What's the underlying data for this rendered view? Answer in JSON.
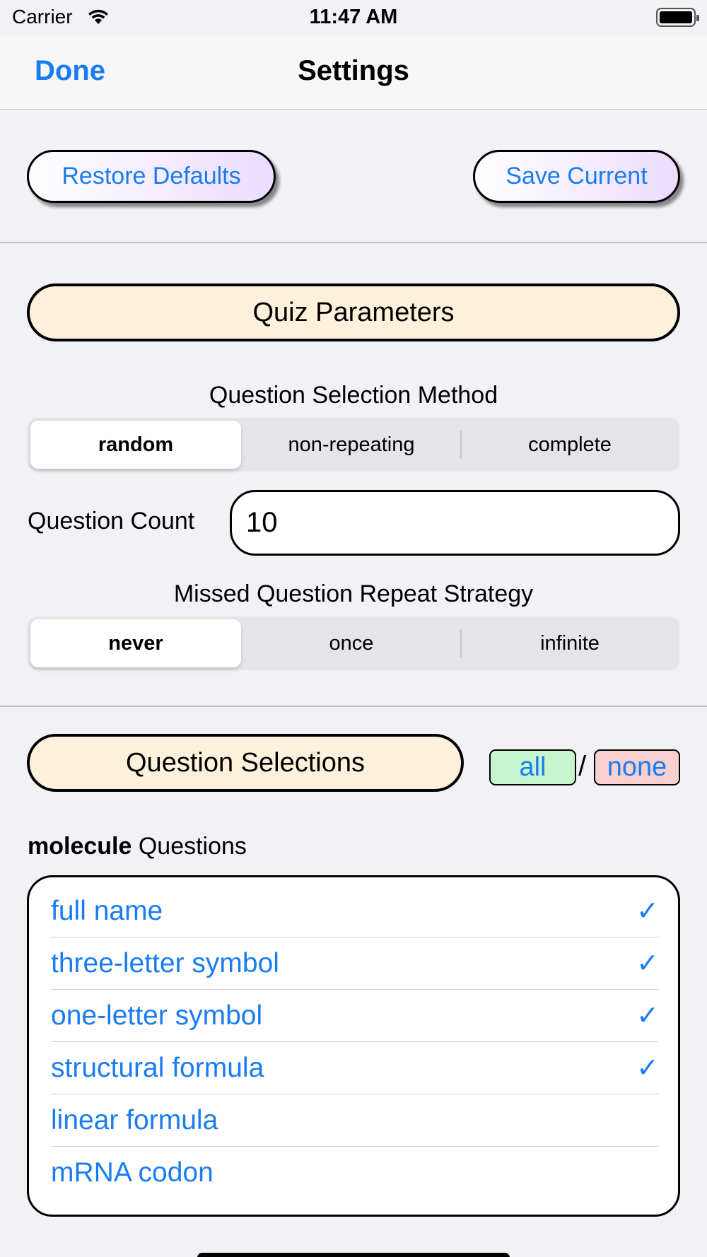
{
  "status_bar": {
    "carrier": "Carrier",
    "time": "11:47 AM"
  },
  "nav": {
    "done_label": "Done",
    "title": "Settings"
  },
  "actions": {
    "restore_label": "Restore Defaults",
    "save_label": "Save Current"
  },
  "quiz_parameters": {
    "header": "Quiz Parameters",
    "selection_method": {
      "label": "Question Selection Method",
      "options": [
        "random",
        "non-repeating",
        "complete"
      ],
      "selected": "random"
    },
    "question_count": {
      "label": "Question Count",
      "value": "10"
    },
    "repeat_strategy": {
      "label": "Missed Question Repeat Strategy",
      "options": [
        "never",
        "once",
        "infinite"
      ],
      "selected": "never"
    }
  },
  "question_selections": {
    "header": "Question Selections",
    "all_label": "all",
    "separator": "/",
    "none_label": "none",
    "group_bold": "molecule",
    "group_suffix": " Questions",
    "check_glyph": "✓",
    "items": [
      {
        "label": "full name",
        "checked": true
      },
      {
        "label": "three-letter symbol",
        "checked": true
      },
      {
        "label": "one-letter symbol",
        "checked": true
      },
      {
        "label": "structural formula",
        "checked": true
      },
      {
        "label": "linear formula",
        "checked": false
      },
      {
        "label": "mRNA codon",
        "checked": false
      }
    ]
  },
  "colors": {
    "accent": "#1a7cf2",
    "section_header_bg": "#fef1db",
    "all_bg": "#c7f5cd",
    "none_bg": "#f8d0d0",
    "background": "#f2f1f6"
  }
}
